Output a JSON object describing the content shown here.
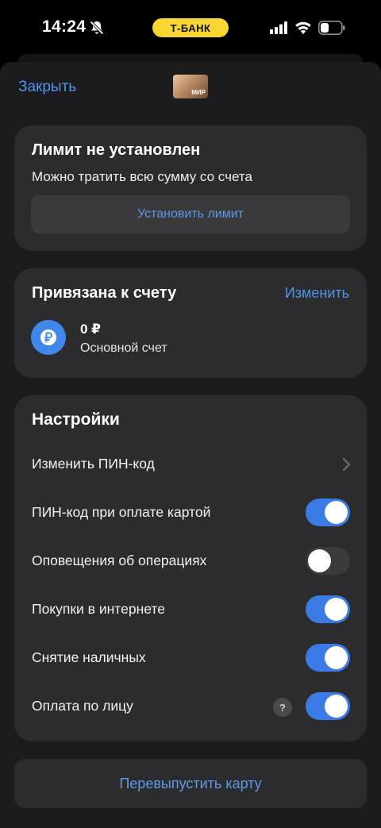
{
  "status_bar": {
    "time": "14:24",
    "operator_pill": "Т-БАНК",
    "icons": [
      "bell-slash-icon",
      "cellular-signal-icon",
      "wifi-icon",
      "battery-icon"
    ]
  },
  "header": {
    "close_label": "Закрыть",
    "card_thumbnail_text": "МИР"
  },
  "limit": {
    "title": "Лимит не установлен",
    "subtitle": "Можно тратить всю сумму со счета",
    "button_label": "Установить лимит"
  },
  "account": {
    "title": "Привязана к счету",
    "change_label": "Изменить",
    "currency_symbol": "₽",
    "amount": "0 ₽",
    "name": "Основной счет"
  },
  "settings": {
    "title": "Настройки",
    "rows": [
      {
        "label": "Изменить ПИН-код",
        "type": "link"
      },
      {
        "label": "ПИН-код при оплате картой",
        "type": "toggle",
        "on": true
      },
      {
        "label": "Оповещения об операциях",
        "type": "toggle",
        "on": false
      },
      {
        "label": "Покупки в интернете",
        "type": "toggle",
        "on": true
      },
      {
        "label": "Снятие наличных",
        "type": "toggle",
        "on": true
      },
      {
        "label": "Оплата по лицу",
        "type": "toggle",
        "on": true,
        "help": "?"
      }
    ]
  },
  "footer": {
    "reissue_label": "Перевыпустить карту"
  },
  "colors": {
    "accent_blue": "#4f94e8",
    "toggle_on": "#3b7be6",
    "pill_yellow": "#f8d532",
    "card_bg": "#2c2c2e",
    "sheet_bg": "#1c1c1e"
  }
}
